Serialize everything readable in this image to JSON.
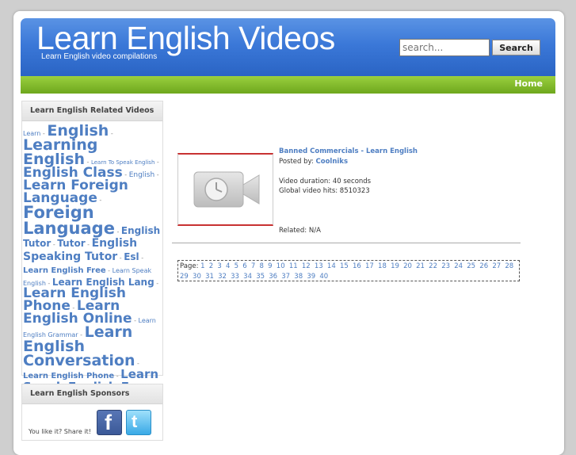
{
  "header": {
    "title": "Learn English Videos",
    "tagline": "Learn English video compilations",
    "search_placeholder": "search...",
    "search_button": "Search"
  },
  "nav": {
    "home": "Home"
  },
  "sidebar": {
    "tags_title": "Learn English Related Videos",
    "tags": [
      {
        "label": "Learn",
        "size": 8
      },
      {
        "label": "English",
        "size": 19
      },
      {
        "label": "Learning English",
        "size": 19
      },
      {
        "label": "Learn To Speak English",
        "size": 7
      },
      {
        "label": "English Class",
        "size": 17
      },
      {
        "label": "English",
        "size": 9
      },
      {
        "label": "Learn Foreign Language",
        "size": 17
      },
      {
        "label": "Foreign Language",
        "size": 21
      },
      {
        "label": "English Tutor",
        "size": 12
      },
      {
        "label": "Tutor",
        "size": 12
      },
      {
        "label": "English Speaking Tutor",
        "size": 14
      },
      {
        "label": "Esl",
        "size": 12
      },
      {
        "label": "Learn English Free",
        "size": 10
      },
      {
        "label": "Learn Speak English",
        "size": 8
      },
      {
        "label": "Learn English Lang",
        "size": 12
      },
      {
        "label": "Learn English Phone",
        "size": 17
      },
      {
        "label": "Learn English Online",
        "size": 17
      },
      {
        "label": "Learn English Grammar",
        "size": 8
      },
      {
        "label": "Learn English Conversation",
        "size": 19
      },
      {
        "label": "Learn English Phone",
        "size": 10
      },
      {
        "label": "Learn Speak English Free",
        "size": 15
      }
    ],
    "sponsors_title": "Learn English Sponsors",
    "share_text": "You like it? Share it!",
    "facebook_glyph": "f",
    "twitter_glyph": "t"
  },
  "video": {
    "title": "Banned Commercials - Learn English",
    "posted_by_label": "Posted by:",
    "posted_by": "Coolniks",
    "duration": "Video duration: 40 seconds",
    "hits": "Global video hits: 8510323",
    "related": "Related: N/A"
  },
  "pager": {
    "label": "Page:",
    "pages": [
      "1",
      "2",
      "3",
      "4",
      "5",
      "6",
      "7",
      "8",
      "9",
      "10",
      "11",
      "12",
      "13",
      "14",
      "15",
      "16",
      "17",
      "18",
      "19",
      "20",
      "21",
      "22",
      "23",
      "24",
      "25",
      "26",
      "27",
      "28",
      "29",
      "30",
      "31",
      "32",
      "33",
      "34",
      "35",
      "36",
      "37",
      "38",
      "39",
      "40"
    ]
  },
  "colors": {
    "header_blue": "#3b78d8",
    "nav_green": "#80b82a",
    "link_blue": "#4e7ec2",
    "thumb_border_red": "#c83232"
  }
}
